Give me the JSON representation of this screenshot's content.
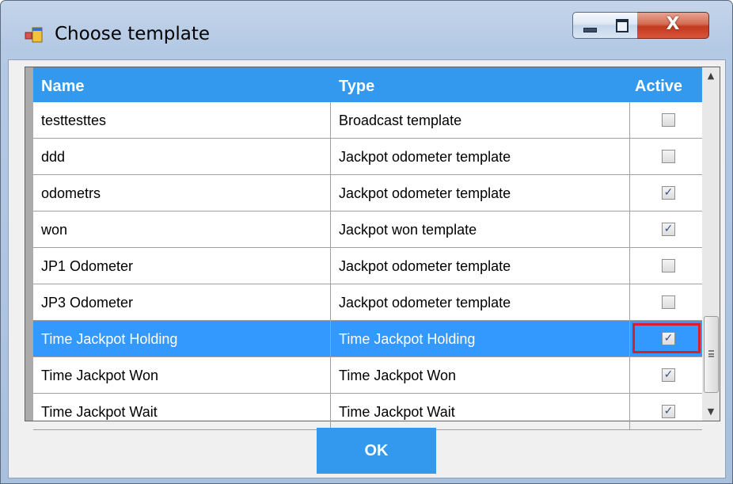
{
  "window": {
    "title": "Choose template",
    "controls": {
      "minimize": "minimize",
      "maximize": "maximize",
      "close": "X"
    }
  },
  "table": {
    "headers": {
      "name": "Name",
      "type": "Type",
      "active": "Active"
    },
    "rows": [
      {
        "name": "testtesttes",
        "type": "Broadcast template",
        "active": false,
        "selected": false
      },
      {
        "name": "ddd",
        "type": "Jackpot odometer template",
        "active": false,
        "selected": false
      },
      {
        "name": "odometrs",
        "type": "Jackpot odometer template",
        "active": true,
        "selected": false
      },
      {
        "name": "won",
        "type": "Jackpot won template",
        "active": true,
        "selected": false
      },
      {
        "name": "JP1 Odometer",
        "type": "Jackpot odometer template",
        "active": false,
        "selected": false
      },
      {
        "name": "JP3 Odometer",
        "type": "Jackpot odometer template",
        "active": false,
        "selected": false
      },
      {
        "name": "Time Jackpot Holding",
        "type": "Time Jackpot Holding",
        "active": true,
        "selected": true,
        "highlighted": true
      },
      {
        "name": "Time Jackpot Won",
        "type": "Time Jackpot Won",
        "active": true,
        "selected": false
      },
      {
        "name": "Time Jackpot Wait",
        "type": "Time Jackpot Wait",
        "active": true,
        "selected": false
      }
    ]
  },
  "footer": {
    "ok_label": "OK"
  },
  "colors": {
    "header_bg": "#3399ee",
    "selected_row_bg": "#3399ff",
    "highlight_border": "#d8202d",
    "ok_button_bg": "#3399ee"
  },
  "icons": {
    "app": "window-app-icon",
    "check": "checkmark-icon",
    "scroll_up": "scroll-up-arrow-icon",
    "scroll_down": "scroll-down-arrow-icon",
    "grip": "scroll-thumb-grip-icon"
  }
}
